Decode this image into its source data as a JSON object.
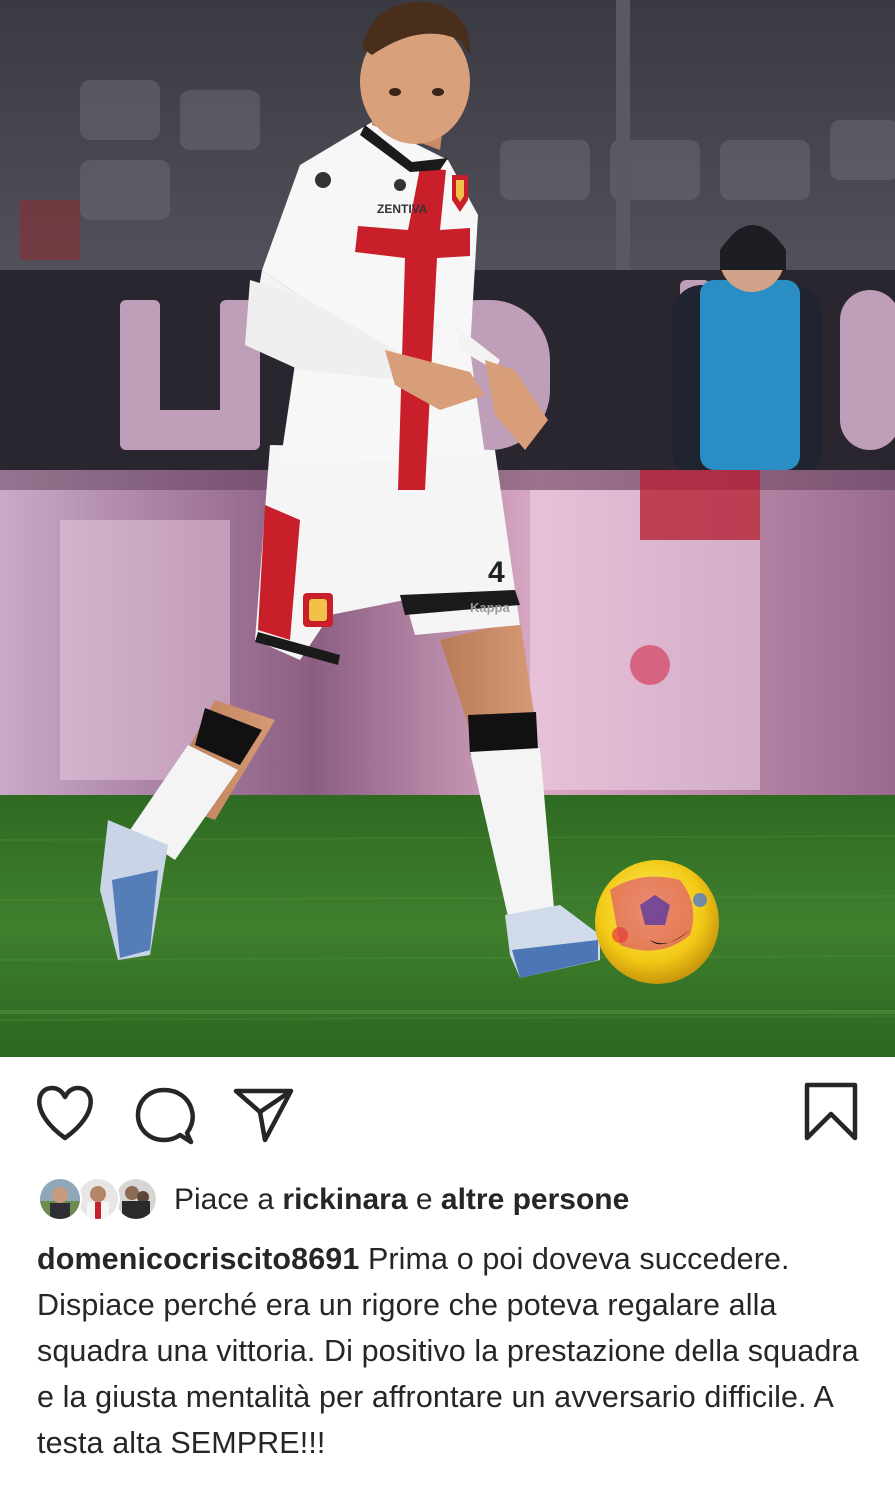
{
  "post": {
    "photo_alt_icon": "football-player-photo",
    "actions": {
      "like_icon": "heart-icon",
      "comment_icon": "comment-icon",
      "share_icon": "paper-plane-icon",
      "save_icon": "bookmark-icon"
    },
    "likes": {
      "prefix": "Piace a",
      "first_user": "rickinara",
      "connector": "e",
      "others": "altre persone"
    },
    "caption": {
      "username": "domenicocriscito8691",
      "text": "Prima o poi doveva succedere. Dispiace perché era un rigore che poteva regalare alla squadra una vittoria. Di positivo la prestazione della squadra e la giusta mentalità per affrontare un avversario difficile. A testa alta SEMPRE!!!"
    },
    "photo_texts": {
      "shirt_sponsor": "ZENTIVA",
      "shirt_brand": "Kappa",
      "shorts_number": "4"
    }
  },
  "colors": {
    "text": "#262626",
    "icon": "#262626",
    "pitch": "#3f7a2c",
    "kit_red": "#c81f2b"
  }
}
